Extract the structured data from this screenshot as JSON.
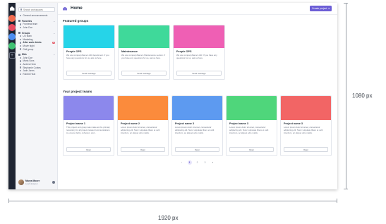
{
  "rail": {
    "workspaces": [
      {
        "name": "workspace-orange",
        "color": "#f26b4f"
      },
      {
        "name": "workspace-red",
        "color": "#e84a5f"
      },
      {
        "name": "workspace-blue",
        "color": "#4b8df0"
      },
      {
        "name": "workspace-green",
        "color": "#3fc272"
      }
    ],
    "add_label": "+"
  },
  "sidebar": {
    "search_placeholder": "Search workspaces",
    "top_item": "General announcements",
    "sections": [
      {
        "title": "Favorites",
        "items": [
          "Frontend team",
          "John Doe"
        ]
      },
      {
        "title": "Groups",
        "items": [
          "UX team",
          "Marketing",
          "After work drinks",
          "Movie night",
          "Golf group"
        ]
      },
      {
        "title": "DMs",
        "items": [
          "John Doe",
          "Maria Sons",
          "Andrea Heck",
          "Stephanie Contes",
          "Jade Jones",
          "Robbie Heat"
        ]
      }
    ],
    "active_item_badge": "3",
    "user": {
      "name": "Marya Moore",
      "role": "Lead designer"
    }
  },
  "topbar": {
    "title": "Home",
    "create_label": "Create project"
  },
  "featured": {
    "title": "Featured groups",
    "cards": [
      {
        "title": "People OPS",
        "color": "#26d4e8",
        "desc": "We are companyName's HR department. If you have any questions for us, ask us here.",
        "button": "Send message"
      },
      {
        "title": "Maintenance",
        "color": "#3fd99a",
        "desc": "We are companyName's Maintenance section. If you have any questions for us, ask us here.",
        "button": "Send message"
      },
      {
        "title": "People OPS",
        "color": "#ef5fb4",
        "desc": "We are companyName's HR. If you have any questions for us, ask us here.",
        "button": "Send message"
      }
    ]
  },
  "teams": {
    "title": "Your project teams",
    "cards": [
      {
        "title": "Project name 1",
        "color": "#8c88ec",
        "desc": "This project and group was made as the primary repository for all project-related communications to ensure clarity, cohesion, and...",
        "button": "Open"
      },
      {
        "title": "Project name 2",
        "color": "#fb8b3c",
        "desc": "Lorem ipsum dolor sit amet, consectetur adipiscing elit. Nunc vulputate libero et velit interdum, ac aliquet odio mattis.",
        "button": "Open"
      },
      {
        "title": "Project name 3",
        "color": "#5d9af0",
        "desc": "Lorem ipsum dolor sit amet, consectetur adipiscing elit. Nunc vulputate libero et velit interdum, ac aliquet odio mattis.",
        "button": "Open"
      },
      {
        "title": "Project name 3",
        "color": "#4fd67b",
        "desc": "Lorem ipsum dolor sit amet, consectetur adipiscing elit. Nunc vulputate libero et velit interdum, ac aliquet odio mattis.",
        "button": "Open"
      },
      {
        "title": "Project name 3",
        "color": "#f26565",
        "desc": "Lorem ipsum dolor sit amet, consectetur adipiscing elit. Nunc vulputate libero et velit interdum, ac aliquet odio mattis.",
        "button": "Open"
      }
    ]
  },
  "pagination": {
    "prev": "‹",
    "pages": [
      "1",
      "2",
      "3"
    ],
    "current": "1",
    "next": "›"
  },
  "annotations": {
    "height_label": "1080 px",
    "width_label": "1920 px"
  }
}
